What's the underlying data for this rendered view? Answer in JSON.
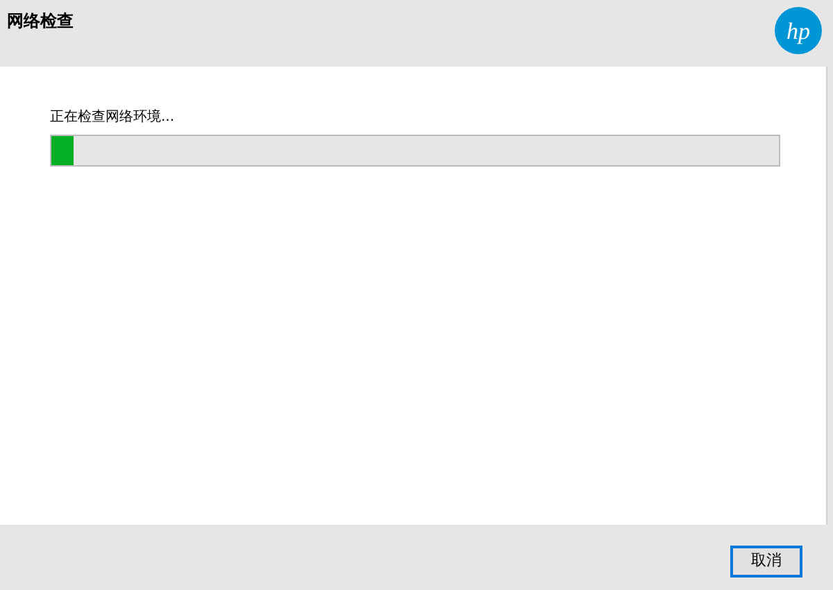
{
  "header": {
    "title": "网络检查",
    "logo_text": "hp"
  },
  "progress": {
    "label": "正在检查网络环境...",
    "level": 0.03
  },
  "buttons": [
    {
      "label": "取消",
      "focused": true
    }
  ]
}
